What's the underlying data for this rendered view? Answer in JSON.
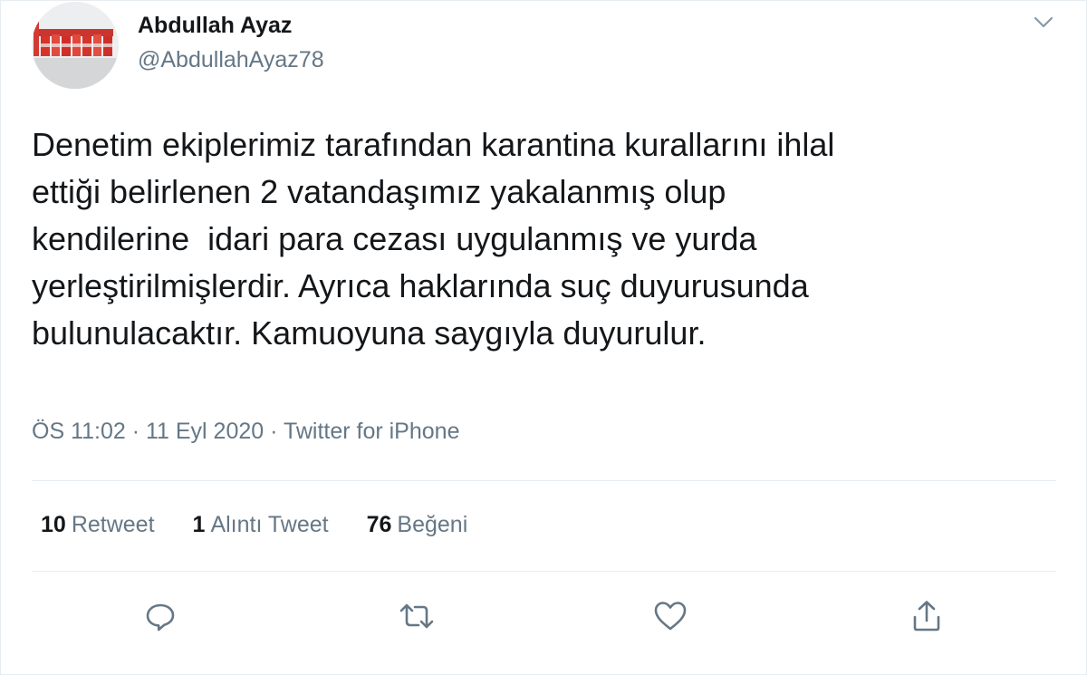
{
  "author": {
    "display_name": "Abdullah Ayaz",
    "handle": "@AbdullahAyaz78"
  },
  "tweet": {
    "text": "Denetim ekiplerimiz tarafından karantina kurallarını ihlal\nettiği belirlenen 2 vatandaşımız yakalanmış olup\nkendilerine  idari para cezası uygulanmış ve yurda\nyerleştirilmişlerdir. Ayrıca haklarında suç duyurusunda\nbulunulacaktır. Kamuoyuna saygıyla duyurulur.",
    "meta": "ÖS 11:02 · 11 Eyl 2020 · Twitter for iPhone"
  },
  "stats": {
    "retweets": {
      "count": "10",
      "label": "Retweet"
    },
    "quotes": {
      "count": "1",
      "label": "Alıntı Tweet"
    },
    "likes": {
      "count": "76",
      "label": "Beğeni"
    }
  },
  "icons": {
    "caret": "chevron-down-icon",
    "reply": "reply-icon",
    "retweet": "retweet-icon",
    "like": "heart-icon",
    "share": "share-icon"
  },
  "colors": {
    "text": "#14171a",
    "secondary": "#657786",
    "divider": "#e6ecf0"
  }
}
